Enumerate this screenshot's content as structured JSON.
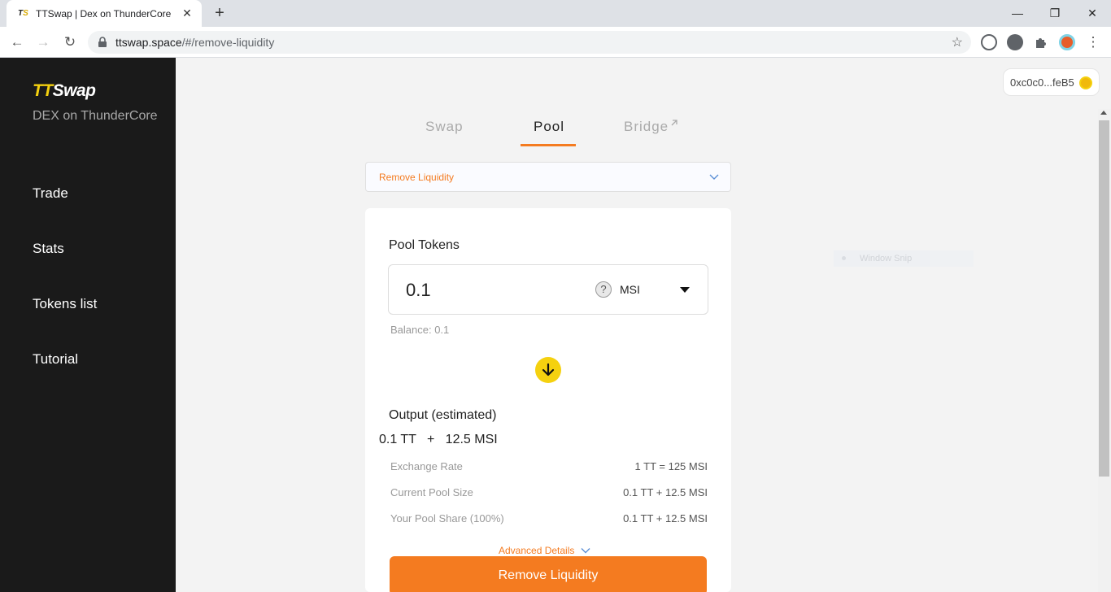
{
  "browser": {
    "tab_title": "TTSwap | Dex on ThunderCore",
    "favicon_text": "TS",
    "url_host": "ttswap.space",
    "url_path": "/#/remove-liquidity"
  },
  "sidebar": {
    "logo_part1": "TT",
    "logo_part2": "Swap",
    "tagline": "DEX on ThunderCore",
    "items": [
      {
        "label": "Trade"
      },
      {
        "label": "Stats"
      },
      {
        "label": "Tokens list"
      },
      {
        "label": "Tutorial"
      }
    ]
  },
  "wallet": {
    "address": "0xc0c0...feB5"
  },
  "nav_tabs": [
    {
      "label": "Swap"
    },
    {
      "label": "Pool"
    },
    {
      "label": "Bridge"
    }
  ],
  "mode_select": {
    "value": "Remove Liquidity"
  },
  "card": {
    "pool_tokens_label": "Pool Tokens",
    "amount": "0.1",
    "token_symbol": "MSI",
    "balance": "Balance: 0.1",
    "output_label": "Output (estimated)",
    "output_value": "0.1 TT   +   12.5 MSI",
    "rows": [
      {
        "label": "Exchange Rate",
        "value": "1 TT = 125 MSI"
      },
      {
        "label": "Current Pool Size",
        "value": "0.1 TT + 12.5 MSI"
      },
      {
        "label": "Your Pool Share (100%)",
        "value": "0.1 TT + 12.5 MSI"
      }
    ],
    "advanced_label": "Advanced Details",
    "submit_label": "Remove Liquidity"
  },
  "overlay": {
    "window_snip_label": "Window Snip"
  },
  "colors": {
    "accent": "#f47b20",
    "brand_yellow": "#f5d10f",
    "sidebar_bg": "#1a1a1a"
  }
}
